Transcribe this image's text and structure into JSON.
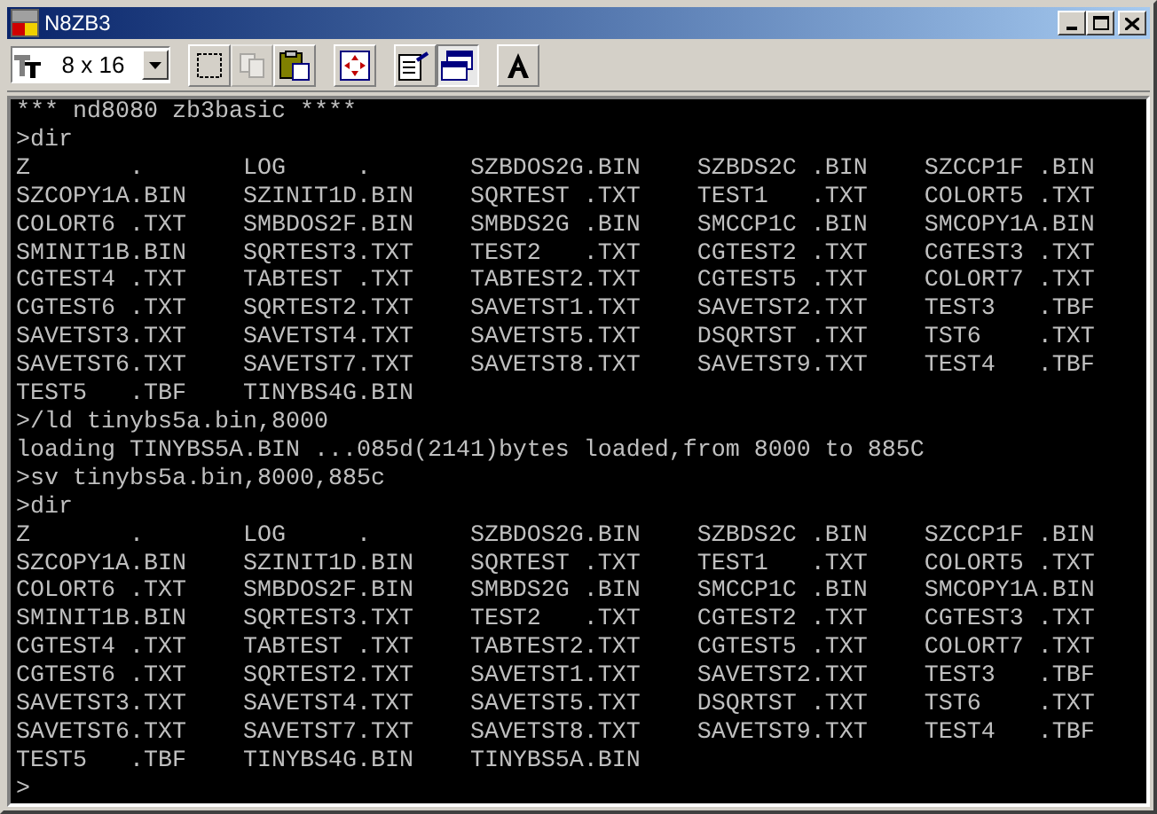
{
  "window": {
    "title": "N8ZB3"
  },
  "toolbar": {
    "font_size": "8 x 16",
    "tools": [
      {
        "kind": "mark",
        "disabled": false,
        "pressed": false
      },
      {
        "kind": "copy",
        "disabled": true,
        "pressed": false
      },
      {
        "kind": "paste",
        "disabled": false,
        "pressed": false
      },
      {
        "kind": "fullscreen",
        "disabled": false,
        "pressed": false
      },
      {
        "kind": "properties",
        "disabled": false,
        "pressed": false
      },
      {
        "kind": "background",
        "disabled": false,
        "pressed": true
      },
      {
        "kind": "font",
        "disabled": false,
        "pressed": false
      }
    ]
  },
  "console": {
    "lines": [
      "*** nd8080 zb3basic ****",
      ">dir",
      "Z       .       LOG     .       SZBDOS2G.BIN    SZBDS2C .BIN    SZCCP1F .BIN",
      "SZCOPY1A.BIN    SZINIT1D.BIN    SQRTEST .TXT    TEST1   .TXT    COLORT5 .TXT",
      "COLORT6 .TXT    SMBDOS2F.BIN    SMBDS2G .BIN    SMCCP1C .BIN    SMCOPY1A.BIN",
      "SMINIT1B.BIN    SQRTEST3.TXT    TEST2   .TXT    CGTEST2 .TXT    CGTEST3 .TXT",
      "CGTEST4 .TXT    TABTEST .TXT    TABTEST2.TXT    CGTEST5 .TXT    COLORT7 .TXT",
      "CGTEST6 .TXT    SQRTEST2.TXT    SAVETST1.TXT    SAVETST2.TXT    TEST3   .TBF",
      "SAVETST3.TXT    SAVETST4.TXT    SAVETST5.TXT    DSQRTST .TXT    TST6    .TXT",
      "SAVETST6.TXT    SAVETST7.TXT    SAVETST8.TXT    SAVETST9.TXT    TEST4   .TBF",
      "TEST5   .TBF    TINYBS4G.BIN",
      ">/ld tinybs5a.bin,8000",
      "loading TINYBS5A.BIN ...085d(2141)bytes loaded,from 8000 to 885C",
      ">sv tinybs5a.bin,8000,885c",
      ">dir",
      "Z       .       LOG     .       SZBDOS2G.BIN    SZBDS2C .BIN    SZCCP1F .BIN",
      "SZCOPY1A.BIN    SZINIT1D.BIN    SQRTEST .TXT    TEST1   .TXT    COLORT5 .TXT",
      "COLORT6 .TXT    SMBDOS2F.BIN    SMBDS2G .BIN    SMCCP1C .BIN    SMCOPY1A.BIN",
      "SMINIT1B.BIN    SQRTEST3.TXT    TEST2   .TXT    CGTEST2 .TXT    CGTEST3 .TXT",
      "CGTEST4 .TXT    TABTEST .TXT    TABTEST2.TXT    CGTEST5 .TXT    COLORT7 .TXT",
      "CGTEST6 .TXT    SQRTEST2.TXT    SAVETST1.TXT    SAVETST2.TXT    TEST3   .TBF",
      "SAVETST3.TXT    SAVETST4.TXT    SAVETST5.TXT    DSQRTST .TXT    TST6    .TXT",
      "SAVETST6.TXT    SAVETST7.TXT    SAVETST8.TXT    SAVETST9.TXT    TEST4   .TBF",
      "TEST5   .TBF    TINYBS4G.BIN    TINYBS5A.BIN",
      ">"
    ]
  }
}
